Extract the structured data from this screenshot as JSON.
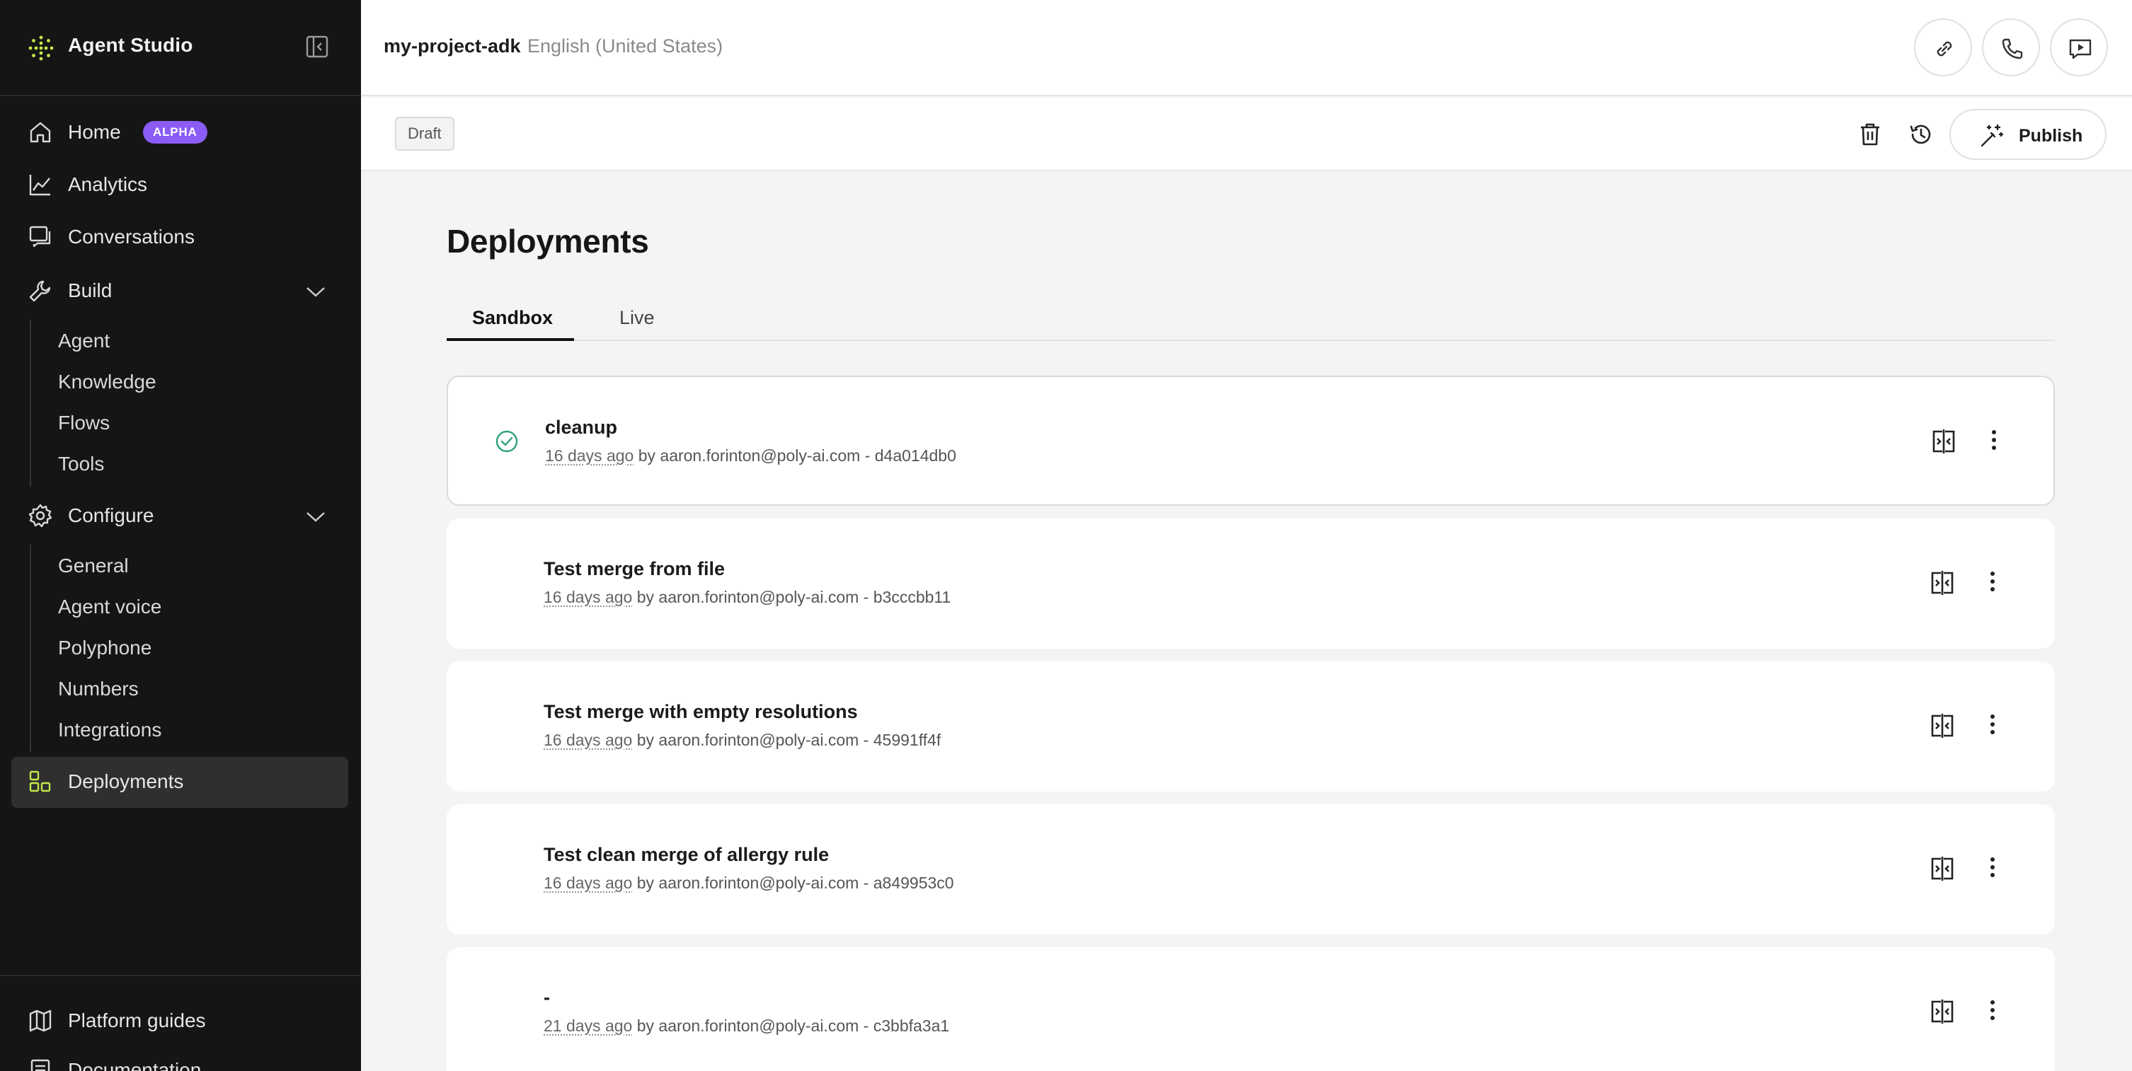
{
  "app": {
    "name": "Agent Studio"
  },
  "sidebar": {
    "nav": [
      {
        "label": "Home",
        "badge": "ALPHA",
        "icon": "home-icon"
      },
      {
        "label": "Analytics",
        "icon": "analytics-icon"
      },
      {
        "label": "Conversations",
        "icon": "conversations-icon"
      },
      {
        "label": "Build",
        "icon": "wrench-icon",
        "expanded": true,
        "children": [
          "Agent",
          "Knowledge",
          "Flows",
          "Tools"
        ]
      },
      {
        "label": "Configure",
        "icon": "gear-icon",
        "expanded": true,
        "children": [
          "General",
          "Agent voice",
          "Polyphone",
          "Numbers",
          "Integrations"
        ]
      },
      {
        "label": "Deployments",
        "icon": "deployments-icon",
        "active": true
      }
    ],
    "footer": [
      {
        "label": "Platform guides",
        "icon": "map-icon"
      },
      {
        "label": "Documentation",
        "icon": "document-icon"
      }
    ]
  },
  "topbar": {
    "project_name": "my-project-adk",
    "language": "English (United States)"
  },
  "subbar": {
    "status_chip": "Draft",
    "publish_label": "Publish"
  },
  "main": {
    "title": "Deployments",
    "tabs": [
      {
        "label": "Sandbox",
        "active": true
      },
      {
        "label": "Live",
        "active": false
      }
    ],
    "deployments": [
      {
        "title": "cleanup",
        "time": "16 days ago",
        "by": "by aaron.forinton@poly-ai.com",
        "sep": "-",
        "hash": "d4a014db0",
        "status": "active"
      },
      {
        "title": "Test merge from file",
        "time": "16 days ago",
        "by": "by aaron.forinton@poly-ai.com",
        "sep": "-",
        "hash": "b3cccbb11",
        "status": "none"
      },
      {
        "title": "Test merge with empty resolutions",
        "time": "16 days ago",
        "by": "by aaron.forinton@poly-ai.com",
        "sep": "-",
        "hash": "45991ff4f",
        "status": "none"
      },
      {
        "title": "Test clean merge of allergy rule",
        "time": "16 days ago",
        "by": "by aaron.forinton@poly-ai.com",
        "sep": "-",
        "hash": "a849953c0",
        "status": "none"
      },
      {
        "title": "-",
        "time": "21 days ago",
        "by": "by aaron.forinton@poly-ai.com",
        "sep": "-",
        "hash": "c3bbfa3a1",
        "status": "none"
      }
    ]
  },
  "colors": {
    "sidebar_bg": "#151515",
    "accent_badge": "#8b5cf6",
    "logo_green": "#c4e84a",
    "success_green": "#2fa37a"
  }
}
